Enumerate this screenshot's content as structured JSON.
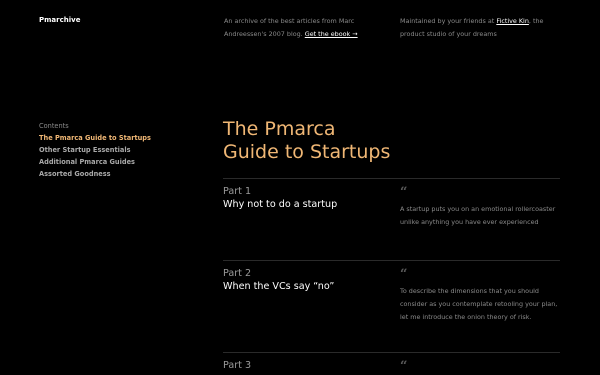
{
  "header": {
    "brand": "Pmarchive",
    "intro_text": "An archive of the best articles from Marc Andreessen's 2007 blog.",
    "ebook_link": "Get the ebook →",
    "maintained_text": "Maintained by your friends at",
    "studio_link": "Fictive Kin",
    "maintained_suffix": ", the product studio of your dreams"
  },
  "toc": {
    "heading": "Contents",
    "items": [
      {
        "label": "The Pmarca Guide to Startups"
      },
      {
        "label": "Other Startup Essentials"
      },
      {
        "label": "Additional Pmarca Guides"
      },
      {
        "label": "Assorted Goodness"
      }
    ]
  },
  "main": {
    "title_line1": "The Pmarca",
    "title_line2": "Guide to Startups",
    "parts": [
      {
        "number": "Part 1",
        "title": "Why not to do a startup",
        "quote": "A startup puts you on an emotional rollercoaster unlike anything you have ever experienced"
      },
      {
        "number": "Part 2",
        "title": "When the VCs say “no”",
        "quote": "To describe the dimensions that you should consider as you contemplate retooling your plan, let me introduce the onion theory of risk."
      },
      {
        "number": "Part 3",
        "title": "",
        "quote": ""
      }
    ]
  },
  "icons": {
    "quote": "“"
  },
  "colors": {
    "background": "#000000",
    "accent": "#f0b775",
    "text_primary": "#ffffff",
    "text_muted": "#8a8a8a"
  }
}
